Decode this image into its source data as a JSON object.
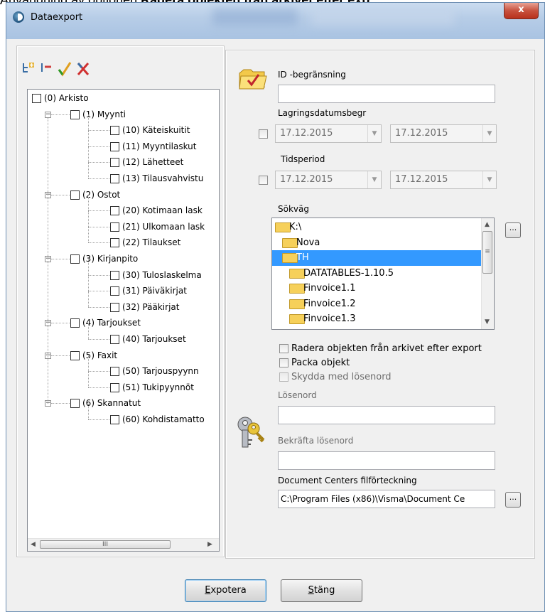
{
  "background_caption": {
    "prefix": "Användning av optionen ",
    "bold": "Radera objekten från arkivet efter exp"
  },
  "window": {
    "title": "Dataexport",
    "close_label": "x"
  },
  "toolbar": {
    "icons": [
      "tree-expand-icon",
      "tree-collapse-icon",
      "check-all-icon",
      "uncheck-all-icon"
    ]
  },
  "tree": {
    "items": [
      {
        "label": "(0) Arkisto",
        "level": 0
      },
      {
        "label": "(1) Myynti",
        "level": 1
      },
      {
        "label": "(10) Käteiskuitit",
        "level": 2
      },
      {
        "label": "(11) Myyntilaskut",
        "level": 2
      },
      {
        "label": "(12) Lähetteet",
        "level": 2
      },
      {
        "label": "(13) Tilausvahvistu",
        "level": 2
      },
      {
        "label": "(2) Ostot",
        "level": 1
      },
      {
        "label": "(20) Kotimaan lask",
        "level": 2
      },
      {
        "label": "(21) Ulkomaan lask",
        "level": 2
      },
      {
        "label": "(22) Tilaukset",
        "level": 2
      },
      {
        "label": "(3) Kirjanpito",
        "level": 1
      },
      {
        "label": "(30) Tuloslaskelma",
        "level": 2
      },
      {
        "label": "(31) Päiväkirjat",
        "level": 2
      },
      {
        "label": "(32) Pääkirjat",
        "level": 2
      },
      {
        "label": "(4) Tarjoukset",
        "level": 1
      },
      {
        "label": "(40) Tarjoukset",
        "level": 2
      },
      {
        "label": "(5) Faxit",
        "level": 1
      },
      {
        "label": "(50) Tarjouspyynn",
        "level": 2
      },
      {
        "label": "(51) Tukipyynnöt",
        "level": 2
      },
      {
        "label": "(6) Skannatut",
        "level": 1
      },
      {
        "label": "(60) Kohdistamatto",
        "level": 2
      }
    ],
    "hscroll_grip": "III"
  },
  "form": {
    "id_label": "ID -begränsning",
    "id_value": "",
    "storage_date_label": "Lagringsdatumsbegr",
    "storage_from": "17.12.2015",
    "storage_to": "17.12.2015",
    "period_label": "Tidsperiod",
    "period_from": "17.12.2015",
    "period_to": "17.12.2015",
    "path_label": "Sökväg",
    "path_items": [
      "K:\\",
      "Nova",
      "TH",
      "DATATABLES-1.10.5",
      "Finvoice1.1",
      "Finvoice1.2",
      "Finvoice1.3"
    ],
    "path_selected": "TH",
    "browse_label": "...",
    "delete_after_export": "Radera objekten från arkivet efter export",
    "pack_objects": "Packa objekt",
    "protect_password": "Skydda med lösenord",
    "password_label": "Lösenord",
    "confirm_password_label": "Bekräfta lösenord",
    "dc_dir_label": "Document Centers filförteckning",
    "dc_dir_value": "C:\\Program Files (x86)\\Visma\\Document Ce",
    "dc_browse_label": "..."
  },
  "buttons": {
    "export_accel": "E",
    "export_rest": "xpotera",
    "close_accel": "S",
    "close_rest": "täng"
  },
  "colors": {
    "selection": "#3399ff",
    "title_close": "#c8513e",
    "folder": "#f6d05a"
  }
}
